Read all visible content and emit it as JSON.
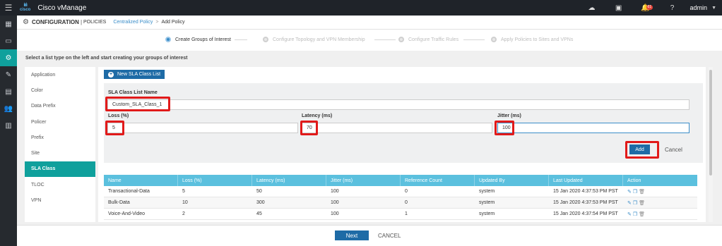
{
  "topbar": {
    "logo_text": "cisco",
    "app_title": "Cisco vManage",
    "notification_count": "61",
    "user": "admin",
    "icons": [
      "cloud-icon",
      "task-icon",
      "bell-icon",
      "help-icon"
    ]
  },
  "leftnav": {
    "icons": [
      "dashboard-icon",
      "monitor-icon",
      "configuration-icon",
      "tools-icon",
      "maintenance-icon",
      "administration-icon",
      "analytics-icon"
    ],
    "active_index": 2
  },
  "header": {
    "title": "CONFIGURATION",
    "separator": "|",
    "section": "POLICIES",
    "breadcrumb_link": "Centralized Policy",
    "breadcrumb_arrow": ">",
    "breadcrumb_current": "Add Policy"
  },
  "steps": [
    {
      "label": "Create Groups of Interest",
      "active": true
    },
    {
      "label": "Configure Topology and VPN Membership",
      "active": false
    },
    {
      "label": "Configure Traffic Rules",
      "active": false
    },
    {
      "label": "Apply Policies to Sites and VPNs",
      "active": false
    }
  ],
  "instruction": "Select a list type on the left and start creating your groups of interest",
  "list_types": [
    "Application",
    "Color",
    "Data Prefix",
    "Policer",
    "Prefix",
    "Site",
    "SLA Class",
    "TLOC",
    "VPN"
  ],
  "active_list_type": "SLA Class",
  "new_button": {
    "icon": "plus-circle-icon",
    "label": "New SLA Class List"
  },
  "form": {
    "name_label": "SLA Class List Name",
    "name_value": "Custom_SLA_Class_1",
    "loss_label": "Loss (%)",
    "loss_value": "5",
    "latency_label": "Latency (ms)",
    "latency_value": "70",
    "jitter_label": "Jitter (ms)",
    "jitter_value": "100",
    "add_label": "Add",
    "cancel_label": "Cancel",
    "highlight_color": "#e11a1a"
  },
  "table": {
    "headers": [
      "Name",
      "Loss (%)",
      "Latency (ms)",
      "Jitter (ms)",
      "Reference Count",
      "Updated By",
      "Last Updated",
      "Action"
    ],
    "rows": [
      [
        "Transactional-Data",
        "5",
        "50",
        "100",
        "0",
        "system",
        "15 Jan 2020 4:37:53 PM PST"
      ],
      [
        "Bulk-Data",
        "10",
        "300",
        "100",
        "0",
        "system",
        "15 Jan 2020 4:37:53 PM PST"
      ],
      [
        "Voice-And-Video",
        "2",
        "45",
        "100",
        "1",
        "system",
        "15 Jan 2020 4:37:54 PM PST"
      ]
    ],
    "action_icons": [
      "edit-icon",
      "copy-icon",
      "delete-icon"
    ],
    "header_color": "#5bc0de"
  },
  "footer": {
    "next_label": "Next",
    "cancel_label": "CANCEL"
  },
  "colors": {
    "accent_teal": "#0fa09c",
    "primary_blue": "#1e6ba6",
    "link_blue": "#3a8dc8",
    "topbar": "#1f2329"
  }
}
